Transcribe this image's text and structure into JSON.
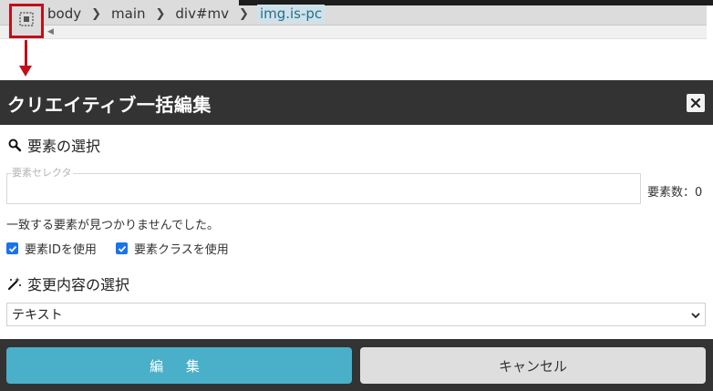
{
  "breadcrumb": {
    "items": [
      "body",
      "main",
      "div#mv",
      "img.is-pc"
    ]
  },
  "dialog": {
    "title": "クリエイティブ一括編集",
    "section_element": "要素の選択",
    "selector_legend": "要素セレクタ",
    "selector_value": "",
    "count_label": "要素数：0",
    "not_found_message": "一致する要素が見つかりませんでした。",
    "use_id_label": "要素IDを使用",
    "use_class_label": "要素クラスを使用",
    "section_change": "変更内容の選択",
    "change_type_selected": "テキスト",
    "edit_button": "編 集",
    "cancel_button": "キャンセル"
  },
  "colors": {
    "header_bg": "#333333",
    "primary": "#4aafc8",
    "highlight_border": "#c0101a",
    "checkbox": "#1a73e8"
  },
  "icons": {
    "select_tool": "element-select-icon",
    "close": "close-icon",
    "search": "search-icon",
    "magic": "magic-wand-icon",
    "dropdown": "chevron-down-icon"
  }
}
